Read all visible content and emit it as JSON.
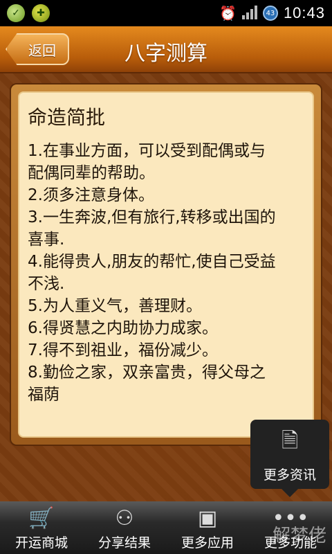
{
  "status_bar": {
    "time": "10:43",
    "battery_badge": "43",
    "icons": [
      "app-icon-green",
      "app-icon-yellow",
      "alarm-icon",
      "signal-icon",
      "battery-badge-icon"
    ]
  },
  "header": {
    "back_label": "返回",
    "title": "八字测算"
  },
  "card": {
    "title": "命造简批",
    "items": [
      "1.在事业方面，可以受到配偶或与",
      "配偶同辈的帮助。",
      "2.须多注意身体。",
      "3.一生奔波,但有旅行,转移或出国的",
      "喜事.",
      "4.能得贵人,朋友的帮忙,使自己受益",
      "不浅.",
      "5.为人重义气，善理财。",
      "6.得贤慧之内助协力成家。",
      "7.得不到祖业，福份减少。",
      "8.勤俭之家，双亲富贵，得父母之",
      "福荫"
    ]
  },
  "tooltip": {
    "label": "更多资讯"
  },
  "bottom_tabs": [
    {
      "label": "开运商城",
      "icon": "cart-icon"
    },
    {
      "label": "分享结果",
      "icon": "share-icon"
    },
    {
      "label": "更多应用",
      "icon": "box-icon"
    },
    {
      "label": "更多功能",
      "icon": "more-icon"
    }
  ],
  "watermark": "解梦佬"
}
